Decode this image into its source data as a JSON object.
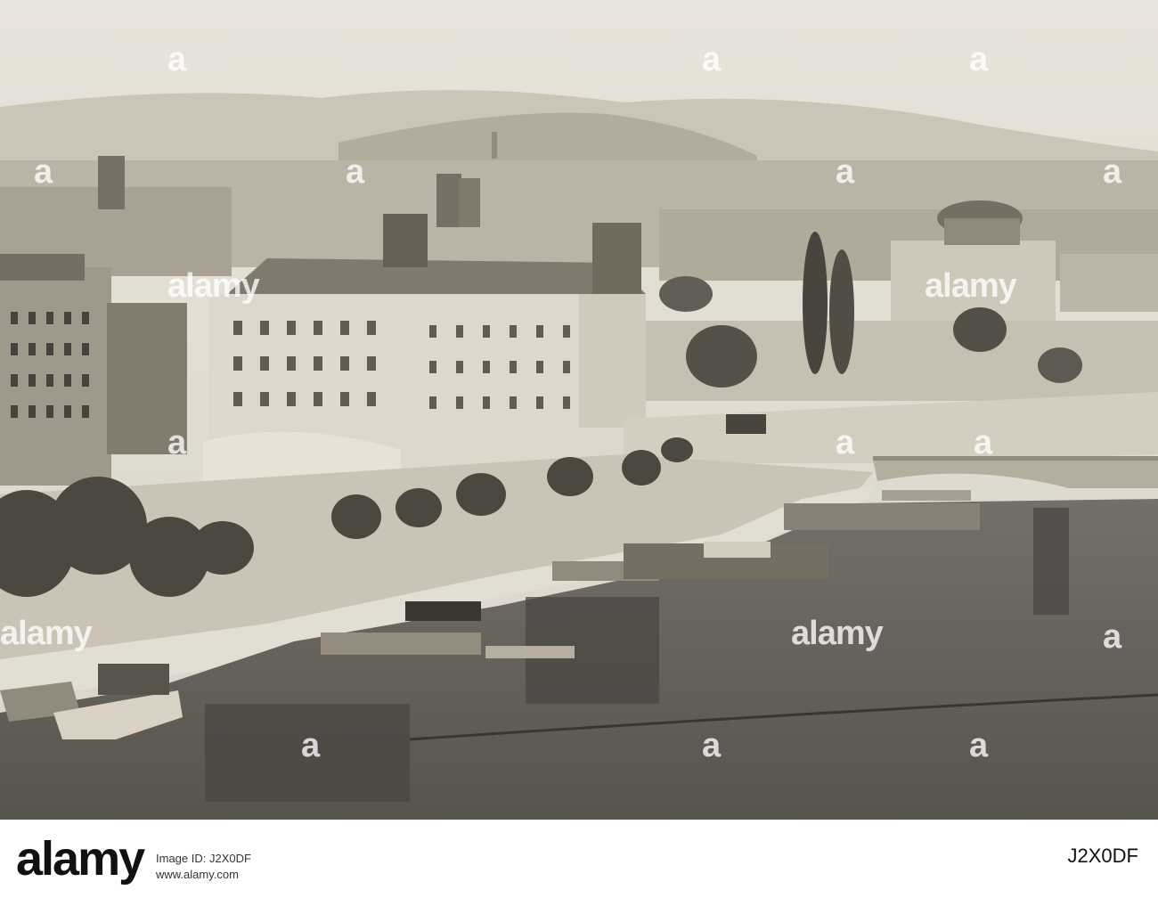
{
  "watermark": {
    "brand": "alamy",
    "tile_text": "a",
    "footer_logo": "alamy",
    "stock_code": "J2X0DF",
    "image_id_label": "Image ID: J2X0DF",
    "site": "www.alamy.com"
  },
  "colors": {
    "sky": "#e4dfd6",
    "water": "#5e5a55",
    "building_light": "#d8d2c6",
    "building_dark": "#6b655c"
  }
}
